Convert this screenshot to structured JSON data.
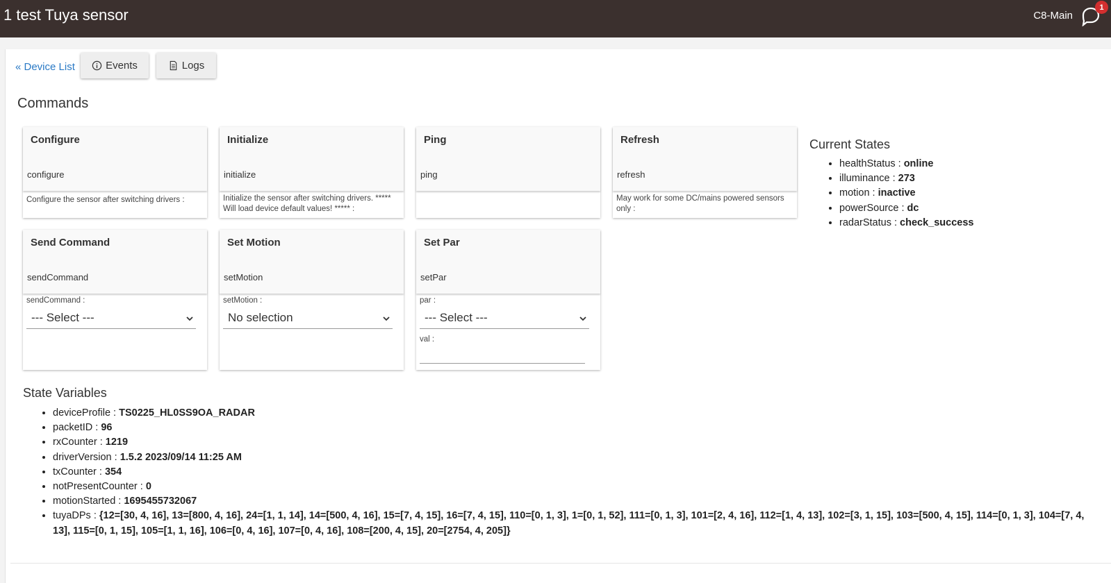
{
  "header": {
    "title": "1 test Tuya sensor",
    "hub_name": "C8-Main",
    "notification_count": "1"
  },
  "nav": {
    "device_list_link": "« Device List",
    "events_label": "Events",
    "logs_label": "Logs"
  },
  "commands": {
    "heading": "Commands",
    "cards": [
      {
        "name": "Configure",
        "method": "configure",
        "description": "Configure the sensor after switching drivers :"
      },
      {
        "name": "Initialize",
        "method": "initialize",
        "description": "Initialize the sensor after switching drivers. ***** Will load device default values! ***** :"
      },
      {
        "name": "Ping",
        "method": "ping",
        "description": ""
      },
      {
        "name": "Refresh",
        "method": "refresh",
        "description": "May work for some DC/mains powered sensors only :"
      },
      {
        "name": "Send Command",
        "method": "sendCommand",
        "param_label": "sendCommand :",
        "select_value": "--- Select ---"
      },
      {
        "name": "Set Motion",
        "method": "setMotion",
        "param_label": "setMotion :",
        "select_value": "No selection"
      },
      {
        "name": "Set Par",
        "method": "setPar",
        "param_label": "par :",
        "select_value": "--- Select ---",
        "param2_label": "val :",
        "param2_value": ""
      }
    ]
  },
  "current_states": {
    "heading": "Current States",
    "items": [
      {
        "key": "healthStatus :",
        "value": "online"
      },
      {
        "key": "illuminance :",
        "value": "273"
      },
      {
        "key": "motion :",
        "value": "inactive"
      },
      {
        "key": "powerSource :",
        "value": "dc"
      },
      {
        "key": "radarStatus :",
        "value": "check_success"
      }
    ]
  },
  "state_variables": {
    "heading": "State Variables",
    "items": [
      {
        "key": "deviceProfile :",
        "value": "TS0225_HL0SS9OA_RADAR"
      },
      {
        "key": "packetID :",
        "value": "96"
      },
      {
        "key": "rxCounter :",
        "value": "1219"
      },
      {
        "key": "driverVersion :",
        "value": "1.5.2 2023/09/14 11:25 AM"
      },
      {
        "key": "txCounter :",
        "value": "354"
      },
      {
        "key": "notPresentCounter :",
        "value": "0"
      },
      {
        "key": "motionStarted :",
        "value": "1695455732067"
      },
      {
        "key": "tuyaDPs :",
        "value": "{12=[30, 4, 16], 13=[800, 4, 16], 24=[1, 1, 14], 14=[500, 4, 16], 15=[7, 4, 15], 16=[7, 4, 15], 110=[0, 1, 3], 1=[0, 1, 52], 111=[0, 1, 3], 101=[2, 4, 16], 112=[1, 4, 13], 102=[3, 1, 15], 103=[500, 4, 15], 114=[0, 1, 3], 104=[7, 4, 13], 115=[0, 1, 15], 105=[1, 1, 16], 106=[0, 4, 16], 107=[0, 4, 16], 108=[200, 4, 15], 20=[2754, 4, 205]}"
      }
    ]
  },
  "colors": {
    "topbar": "#3b302e",
    "link": "#2979c5",
    "badge": "#d32f2f"
  }
}
